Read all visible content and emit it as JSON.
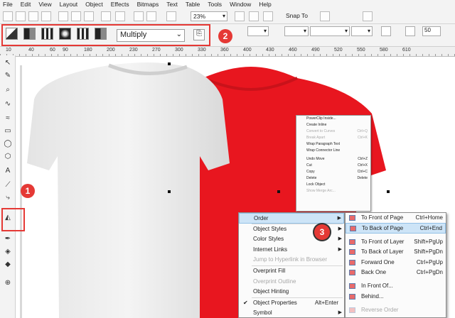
{
  "menubar": [
    "File",
    "Edit",
    "View",
    "Layout",
    "Object",
    "Effects",
    "Bitmaps",
    "Text",
    "Table",
    "Tools",
    "Window",
    "Help"
  ],
  "toolbar": {
    "zoom": "23%",
    "snap_to": "Snap To"
  },
  "property_bar": {
    "blend_mode": "Multiply",
    "stroke_width": "50"
  },
  "badges": [
    "1",
    "2",
    "3"
  ],
  "ruler_labels": [
    "10",
    "40",
    "60",
    "90",
    "180",
    "200",
    "230",
    "270",
    "300",
    "330",
    "360",
    "400",
    "430",
    "460",
    "490",
    "520",
    "550",
    "580",
    "610"
  ],
  "colors": {
    "accent_red": "#e53935",
    "shirt_red": "#e8161f",
    "menu_highlight": "#cde4f7"
  },
  "context_small": [
    {
      "label": "PowerClip Inside...",
      "key": ""
    },
    {
      "label": "Create Inline",
      "key": ""
    },
    {
      "label": "Convert to Curves",
      "key": "Ctrl+Q"
    },
    {
      "label": "Break Apart",
      "key": "Ctrl+K"
    },
    {
      "label": "Wrap Paragraph Text",
      "key": ""
    },
    {
      "label": "Wrap Connector Line",
      "key": ""
    },
    {
      "label": "Undo Move",
      "key": "Ctrl+Z"
    },
    {
      "label": "Cut",
      "key": "Ctrl+X"
    },
    {
      "label": "Copy",
      "key": "Ctrl+C"
    },
    {
      "label": "Delete",
      "key": "Delete"
    },
    {
      "label": "Lock Object",
      "key": ""
    },
    {
      "label": "Show Merge Arc...",
      "key": ""
    }
  ],
  "context_menu": [
    {
      "label": "Order",
      "key": "",
      "arrow": true,
      "state": "selected"
    },
    {
      "label": "Object Styles",
      "key": "",
      "arrow": true,
      "state": ""
    },
    {
      "label": "Color Styles",
      "key": "",
      "arrow": true,
      "state": ""
    },
    {
      "label": "Internet Links",
      "key": "",
      "arrow": true,
      "state": ""
    },
    {
      "label": "Jump to Hyperlink in Browser",
      "key": "",
      "arrow": false,
      "state": "disabled"
    },
    {
      "label": "Overprint Fill",
      "key": "",
      "arrow": false,
      "state": ""
    },
    {
      "label": "Overprint Outline",
      "key": "",
      "arrow": false,
      "state": "disabled"
    },
    {
      "label": "Object Hinting",
      "key": "",
      "arrow": false,
      "state": ""
    },
    {
      "label": "Object Properties",
      "key": "Alt+Enter",
      "arrow": false,
      "state": "checked"
    },
    {
      "label": "Symbol",
      "key": "",
      "arrow": true,
      "state": ""
    }
  ],
  "order_submenu": [
    {
      "label": "To Front of Page",
      "key": "Ctrl+Home",
      "state": ""
    },
    {
      "label": "To Back of Page",
      "key": "Ctrl+End",
      "state": "selected"
    },
    {
      "label": "To Front of Layer",
      "key": "Shift+PgUp",
      "state": ""
    },
    {
      "label": "To Back of Layer",
      "key": "Shift+PgDn",
      "state": ""
    },
    {
      "label": "Forward One",
      "key": "Ctrl+PgUp",
      "state": ""
    },
    {
      "label": "Back One",
      "key": "Ctrl+PgDn",
      "state": ""
    },
    {
      "label": "In Front Of...",
      "key": "",
      "state": ""
    },
    {
      "label": "Behind...",
      "key": "",
      "state": ""
    },
    {
      "label": "Reverse Order",
      "key": "",
      "state": "disabled"
    }
  ]
}
